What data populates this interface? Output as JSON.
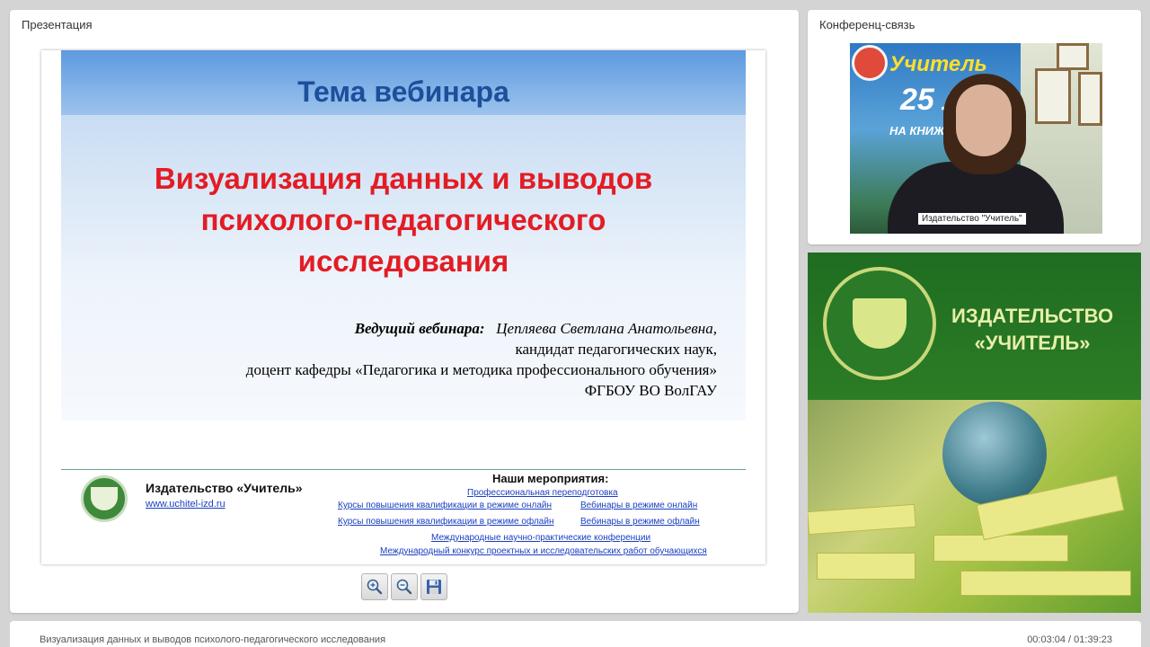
{
  "presentation": {
    "title": "Презентация",
    "slide": {
      "header": "Тема вебинара",
      "main_title_lines": [
        "Визуализация данных и выводов",
        "психолого-педагогического",
        "исследования"
      ],
      "presenter_role": "Ведущий вебинара",
      "presenter_name": "Цепляева Светлана Анатольевна,",
      "presenter_lines": [
        "кандидат педагогических наук,",
        "доцент кафедры «Педагогика и методика профессионального обучения»",
        "ФГБОУ ВО ВолГАУ"
      ],
      "footer": {
        "publisher": "Издательство «Учитель»",
        "url": "www.uchitel-izd.ru",
        "events_title": "Наши мероприятия:",
        "events": [
          "Профессиональная переподготовка",
          "Курсы повышения квалификации в режиме онлайн",
          "Вебинары в режиме онлайн",
          "Курсы повышения квалификации в режиме офлайн",
          "Вебинары в режиме офлайн",
          "Международные научно-практические конференции",
          "Международный конкурс проектных и исследовательских работ обучающихся"
        ]
      }
    },
    "toolbar": {
      "zoom_in_icon": "zoom-in-icon",
      "zoom_out_icon": "zoom-out-icon",
      "save_icon": "floppy-disk-icon"
    }
  },
  "conference": {
    "title": "Конференц-связь",
    "video_label": "Издательство \"Учитель\"",
    "poster": {
      "line1": "Учитель",
      "line2": "25 л",
      "line3": "НА КНИЖНО"
    }
  },
  "ad": {
    "lines": [
      "ИЗДАТЕЛЬСТВО",
      "«УЧИТЕЛЬ»"
    ]
  },
  "status": {
    "title": "Визуализация данных и выводов психолого-педагогического исследования",
    "time": "00:03:04 / 01:39:23"
  },
  "colors": {
    "slide_title_red": "#e31c24",
    "slide_header_blue": "#1c4f9c",
    "link_blue": "#1a3fbf",
    "ad_green": "#2f7d2b"
  }
}
